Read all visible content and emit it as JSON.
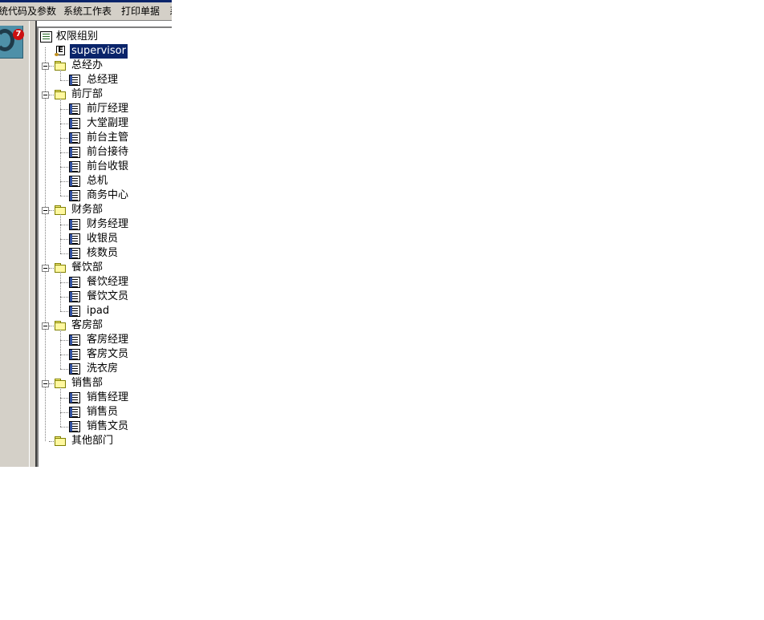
{
  "menubar": {
    "items": [
      "系统代码及参数",
      "系统工作表",
      "打印单据",
      "系"
    ]
  },
  "app": {
    "badge_count": "7"
  },
  "tree": {
    "root_label": "权限组别",
    "selected_label": "supervisor",
    "groups": [
      {
        "label": "总经办",
        "children": [
          "总经理"
        ]
      },
      {
        "label": "前厅部",
        "children": [
          "前厅经理",
          "大堂副理",
          "前台主管",
          "前台接待",
          "前台收银",
          "总机",
          "商务中心"
        ]
      },
      {
        "label": "财务部",
        "children": [
          "财务经理",
          "收银员",
          "核数员"
        ]
      },
      {
        "label": "餐饮部",
        "children": [
          "餐饮经理",
          "餐饮文员",
          "ipad"
        ]
      },
      {
        "label": "客房部",
        "children": [
          "客房经理",
          "客房文员",
          "洗衣房"
        ]
      },
      {
        "label": "销售部",
        "children": [
          "销售经理",
          "销售员",
          "销售文员"
        ]
      },
      {
        "label": "其他部门",
        "children": []
      }
    ]
  },
  "colors": {
    "selection_bg": "#0a246a",
    "panel_gray": "#d4d0c8"
  }
}
